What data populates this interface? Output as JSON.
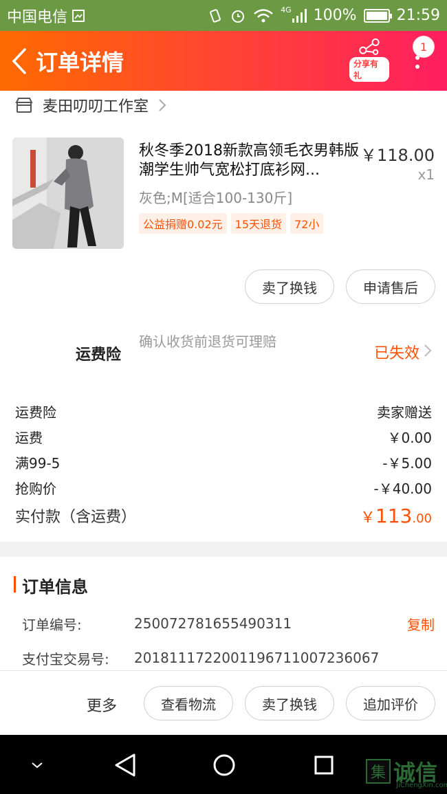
{
  "status_bar": {
    "carrier": "中国电信",
    "network": "4G",
    "battery": "100%",
    "time": "21:59"
  },
  "header": {
    "title": "订单详情",
    "share_label": "分享有礼",
    "more_badge_count": "1"
  },
  "shop": {
    "name": "麦田叨叨工作室"
  },
  "product": {
    "title": "秋冬季2018新款高领毛衣男韩版潮学生帅气宽松打底衫网...",
    "price": "￥118.00",
    "qty": "x1",
    "sku": "灰色;M[适合100-130斤]",
    "tags": [
      "公益捐赠0.02元",
      "15天退货",
      "72小"
    ]
  },
  "item_actions": {
    "sell_label": "卖了换钱",
    "aftersale_label": "申请售后"
  },
  "insurance": {
    "label": "运费险",
    "desc": "确认收货前退货可理赔",
    "status": "已失效"
  },
  "costs": [
    {
      "k": "运费险",
      "v": "卖家赠送"
    },
    {
      "k": "运费",
      "v": "￥0.00"
    },
    {
      "k": "满99-5",
      "v": "-￥5.00"
    },
    {
      "k": "抢购价",
      "v": "-￥40.00"
    }
  ],
  "total": {
    "label": "实付款（含运费）",
    "currency": "￥",
    "int": "113",
    "dec": ".00"
  },
  "order_info": {
    "title": "订单信息",
    "order_no_label": "订单编号:",
    "order_no": "250072781655490311",
    "copy_label": "复制",
    "alipay_label": "支付宝交易号:",
    "alipay_no": "2018111722001196711007236067"
  },
  "bottom_bar": {
    "more": "更多",
    "logistics": "查看物流",
    "sell": "卖了换钱",
    "review": "追加评价"
  },
  "watermark": {
    "box_char": "集",
    "text": "诚信",
    "url": "JiChengXin.com"
  },
  "colors": {
    "accent": "#ff5000",
    "header_start": "#ff6a00",
    "header_end": "#ff1e60",
    "status_bar": "#6c9a44"
  }
}
